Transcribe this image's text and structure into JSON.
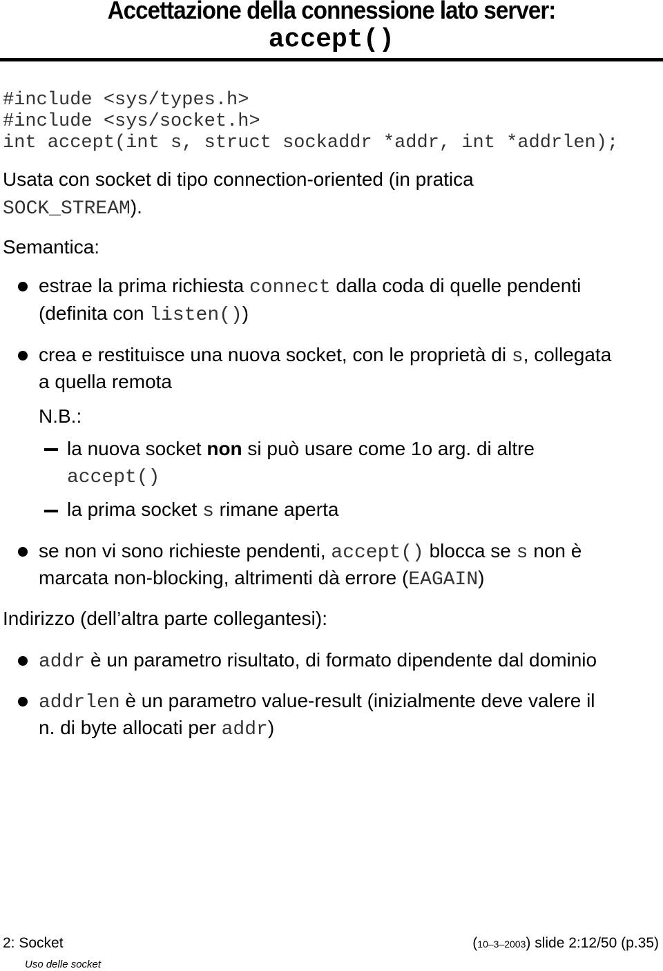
{
  "title": {
    "line1": "Accettazione della connessione lato server:",
    "line2": "accept()"
  },
  "code": [
    "#include <sys/types.h>",
    "#include <sys/socket.h>",
    "int accept(int s, struct sockaddr *addr, int *addrlen);"
  ],
  "usage": {
    "text1": "Usata con socket di tipo connection-oriented (in pratica",
    "mono": "SOCK_STREAM",
    "text2": ")."
  },
  "semantica_label": "Semantica:",
  "bullets": {
    "b1": {
      "a": "estrae la prima richiesta ",
      "m1": "connect",
      "b": " dalla coda di quelle pendenti",
      "c": "(definita con ",
      "m2": "listen()",
      "d": ")"
    },
    "b2": {
      "a": "crea e restituisce una nuova socket, con le proprietà di ",
      "m1": "s",
      "b": ", collegata",
      "c": "a quella remota"
    },
    "nb_label": "N.B.:",
    "d1": {
      "a": "la nuova socket ",
      "bold": "non",
      "b": " si può usare come 1o arg. di altre",
      "m1": "accept()"
    },
    "d2": {
      "a": "la prima socket ",
      "m1": "s",
      "b": " rimane aperta"
    },
    "b3": {
      "a": "se non vi sono richieste pendenti, ",
      "m1": "accept()",
      "b": " blocca se ",
      "m2": "s",
      "c": " non è",
      "d": "marcata non-blocking, altrimenti dà errore (",
      "m3": "EAGAIN",
      "e": ")"
    }
  },
  "indirizzo_label": "Indirizzo (dell’altra parte collegantesi):",
  "addr_bullets": {
    "a1": {
      "m1": "addr",
      "a": " è un parametro risultato, di formato dipendente dal dominio"
    },
    "a2": {
      "m1": "addrlen",
      "a": " è un parametro value-result (inizialmente deve valere il",
      "b": "n. di byte allocati per ",
      "m2": "addr",
      "c": ")"
    }
  },
  "footer": {
    "left": "2: Socket",
    "subtitle": "Uso delle socket",
    "date": "10–3–2003",
    "slide": "slide 2:12/50 (p.35)"
  }
}
